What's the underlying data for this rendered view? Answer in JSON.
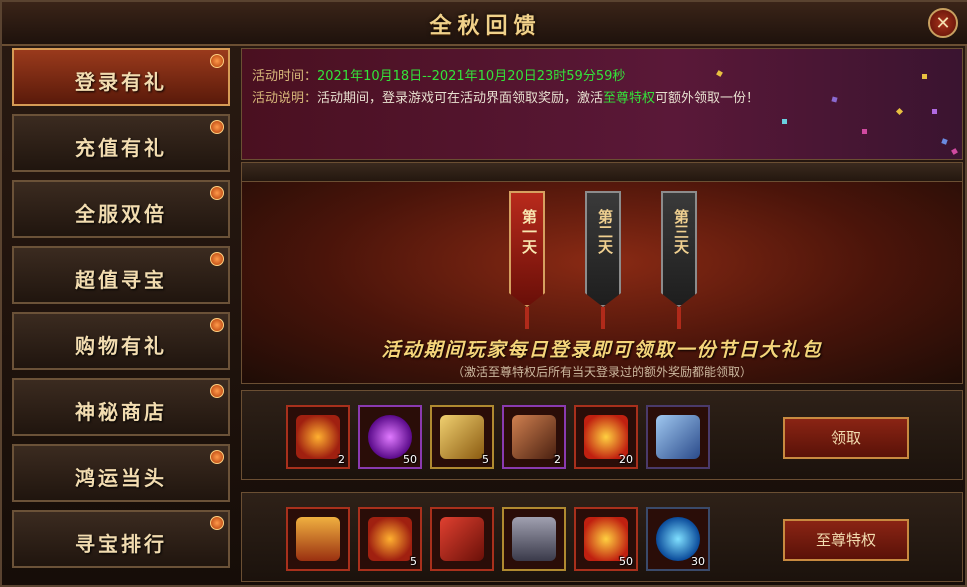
{
  "window": {
    "title": "全秋回馈",
    "close_label": "✕"
  },
  "sidebar": {
    "items": [
      {
        "label": "登录有礼",
        "active": true
      },
      {
        "label": "充值有礼",
        "active": false
      },
      {
        "label": "全服双倍",
        "active": false
      },
      {
        "label": "超值寻宝",
        "active": false
      },
      {
        "label": "购物有礼",
        "active": false
      },
      {
        "label": "神秘商店",
        "active": false
      },
      {
        "label": "鸿运当头",
        "active": false
      },
      {
        "label": "寻宝排行",
        "active": false
      }
    ]
  },
  "info": {
    "time_label": "活动时间：",
    "time_value": "2021年10月18日--2021年10月20日23时59分59秒",
    "desc_label": "活动说明：",
    "desc_before": "活动期间，登录游戏可在活动界面领取奖励，激活",
    "desc_highlight": "至尊特权",
    "desc_after": "可额外领取一份！"
  },
  "days": [
    {
      "label": "第一天",
      "active": true
    },
    {
      "label": "第二天",
      "active": false
    },
    {
      "label": "第三天",
      "active": false
    }
  ],
  "headline": "活动期间玩家每日登录即可领取一份节日大礼包",
  "subline": "（激活至尊特权后所有当天登录过的额外奖励都能领取）",
  "reward_rows": [
    {
      "button_label": "领取",
      "items": [
        {
          "icon": "golden-axe-icon",
          "qty": "2"
        },
        {
          "icon": "purple-orb-icon",
          "qty": "50"
        },
        {
          "icon": "horn-icon",
          "qty": "5"
        },
        {
          "icon": "scroll-bundle-icon",
          "qty": "2"
        },
        {
          "icon": "reward-token-icon",
          "qty": "20"
        },
        {
          "icon": "blue-scroll-icon",
          "qty": ""
        }
      ]
    },
    {
      "button_label": "至尊特权",
      "items": [
        {
          "icon": "treasure-chest-icon",
          "qty": ""
        },
        {
          "icon": "golden-axe-icon",
          "qty": "5"
        },
        {
          "icon": "red-scroll-icon",
          "qty": ""
        },
        {
          "icon": "iron-chest-icon",
          "qty": ""
        },
        {
          "icon": "reward-token-icon",
          "qty": "50"
        },
        {
          "icon": "blue-orb-icon",
          "qty": "30"
        }
      ]
    }
  ],
  "colors": {
    "accent_gold": "#f0d18a",
    "highlight_green": "#34e33a",
    "active_red": "#9a3a1c"
  }
}
